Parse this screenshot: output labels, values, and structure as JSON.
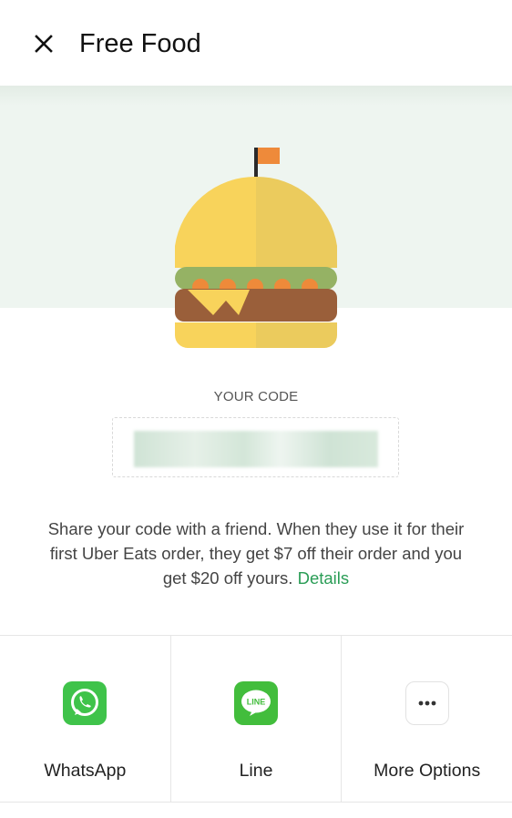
{
  "header": {
    "close_icon": "close-icon",
    "title": "Free Food"
  },
  "hero": {
    "illustration": "burger-illustration",
    "band_color": "#eef5f0"
  },
  "code": {
    "label": "YOUR CODE"
  },
  "description": {
    "text": "Share your code with a friend. When they use it for their first Uber Eats order, they get $7 off their order and you get $20 off yours.",
    "link_label": "Details",
    "link_color": "#2a9d56"
  },
  "share": {
    "options": [
      {
        "label": "WhatsApp",
        "icon": "whatsapp-icon",
        "color": "#3fc34a"
      },
      {
        "label": "Line",
        "icon": "line-icon",
        "color": "#42bd3c"
      },
      {
        "label": "More Options",
        "icon": "more-options-icon"
      }
    ]
  }
}
